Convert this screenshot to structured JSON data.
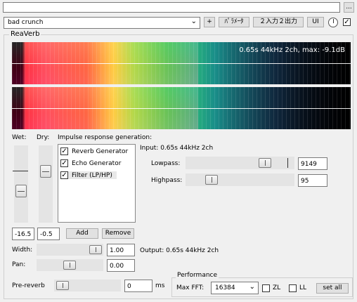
{
  "top": {
    "path_value": "",
    "browse_label": "...",
    "preset_value": "bad crunch",
    "plus_label": "+",
    "params_label": "ﾊﾟﾗﾒｰﾀ",
    "io_label": "２入力２出力",
    "ui_label": "UI",
    "enabled_checked": "✓"
  },
  "plugin": {
    "title": "ReaVerb"
  },
  "display": {
    "info": "0.65s 44kHz 2ch, max: -9.1dB"
  },
  "wet": {
    "label": "Wet:",
    "value": "-16.5",
    "level": 0.45
  },
  "dry": {
    "label": "Dry:",
    "value": "-0.5",
    "level": 0.85
  },
  "impulse": {
    "heading": "Impulse response generation:",
    "items": [
      {
        "label": "Reverb Generator",
        "checked": "✓"
      },
      {
        "label": "Echo Generator",
        "checked": "✓"
      },
      {
        "label": "Filter (LP/HP)",
        "checked": "✓"
      }
    ],
    "add_label": "Add",
    "remove_label": "Remove"
  },
  "input_info": "Input: 0.65s 44kHz 2ch",
  "lowpass": {
    "label": "Lowpass:",
    "value": "9149"
  },
  "highpass": {
    "label": "Highpass:",
    "value": "95"
  },
  "width": {
    "label": "Width:",
    "value": "1.00"
  },
  "pan": {
    "label": "Pan:",
    "value": "0.00"
  },
  "output_info": "Output: 0.65s 44kHz 2ch",
  "prereverb": {
    "label": "Pre-reverb",
    "value": "0",
    "unit": "ms"
  },
  "performance": {
    "title": "Performance",
    "maxfft_label": "Max FFT:",
    "maxfft_value": "16384",
    "zl_label": "ZL",
    "ll_label": "LL",
    "setall_label": "set all"
  }
}
